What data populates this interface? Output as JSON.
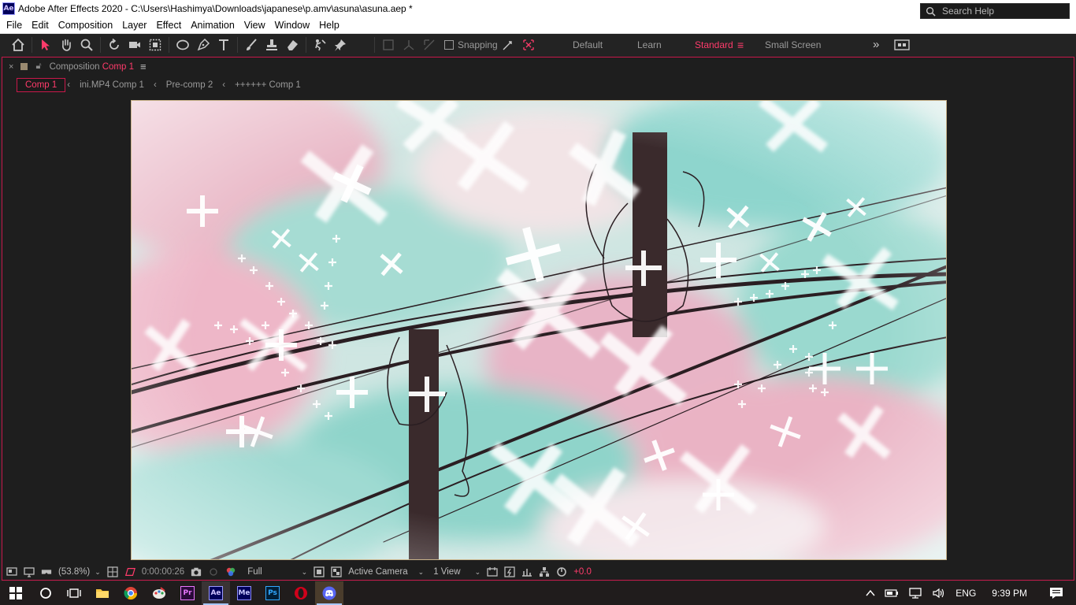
{
  "window": {
    "app_icon": "Ae",
    "title": "Adobe After Effects 2020 - C:\\Users\\Hashimya\\Downloads\\japanese\\p.amv\\asuna\\asuna.aep *",
    "minimize": "—",
    "maximize": "❐",
    "close": "✕"
  },
  "menu": [
    "File",
    "Edit",
    "Composition",
    "Layer",
    "Effect",
    "Animation",
    "View",
    "Window",
    "Help"
  ],
  "toolbar": {
    "snapping_label": "Snapping",
    "workspaces": [
      "Default",
      "Learn",
      "Standard",
      "Small Screen"
    ],
    "active_workspace": "Standard",
    "more": "»",
    "search_placeholder": "Search Help"
  },
  "panel": {
    "close": "×",
    "title_prefix": "Composition",
    "title_comp": "Comp 1",
    "menu": "≡",
    "breadcrumbs": [
      "Comp 1",
      "ini.MP4 Comp 1",
      "Pre-comp 2",
      "++++++ Comp 1"
    ],
    "crumb_sep": "‹"
  },
  "viewer_bar": {
    "zoom": "(53.8%)",
    "timecode": "0:00:00:26",
    "resolution": "Full",
    "camera": "Active Camera",
    "views": "1 View",
    "exposure": "+0.0"
  },
  "taskbar": {
    "language": "ENG",
    "time": "9:39 PM",
    "apps": [
      "Pr",
      "Ae",
      "Me",
      "Ps"
    ]
  },
  "colors": {
    "accent": "#ff3b6b",
    "panel_border": "#c8184a",
    "ae_purple": "#00005b",
    "pr_purple": "#2a0a3a",
    "me_blue": "#00005b",
    "ps_blue": "#001e36"
  }
}
